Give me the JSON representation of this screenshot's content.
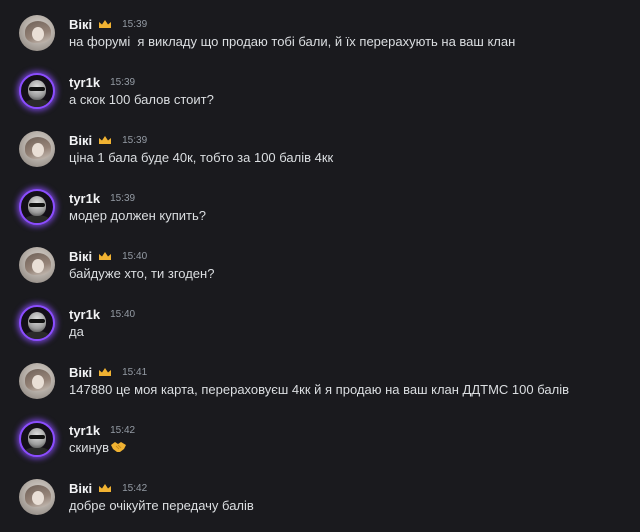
{
  "colors": {
    "background": "#1a1a1e",
    "username": "#f2f3f5",
    "message_text": "#dbdee1",
    "timestamp": "#949ba4",
    "avatar_ring": "#8b4dff",
    "crown": "#f0b232"
  },
  "messages": [
    {
      "author": "Вікі",
      "badge": "crown-icon",
      "time": "15:39",
      "text": "на форумі  я викладу що продаю тобі бали, й їх перерахують на ваш клан"
    },
    {
      "author": "tyr1k",
      "time": "15:39",
      "text": "а скок 100 балов стоит?"
    },
    {
      "author": "Вікі",
      "badge": "crown-icon",
      "time": "15:39",
      "text": "ціна 1 бала буде 40к, тобто за 100 балів 4кк"
    },
    {
      "author": "tyr1k",
      "time": "15:39",
      "text": "модер должен купить?"
    },
    {
      "author": "Вікі",
      "badge": "crown-icon",
      "time": "15:40",
      "text": "байдуже хто, ти згоден?"
    },
    {
      "author": "tyr1k",
      "time": "15:40",
      "text": "да"
    },
    {
      "author": "Вікі",
      "badge": "crown-icon",
      "time": "15:41",
      "text": "147880 це моя карта, перераховуєш 4кк й я продаю на ваш клан ДДТМС 100 балів"
    },
    {
      "author": "tyr1k",
      "time": "15:42",
      "text": "скинув",
      "emoji": "handshake-icon"
    },
    {
      "author": "Вікі",
      "badge": "crown-icon",
      "time": "15:42",
      "text": "добре очікуйте передачу балів"
    }
  ]
}
